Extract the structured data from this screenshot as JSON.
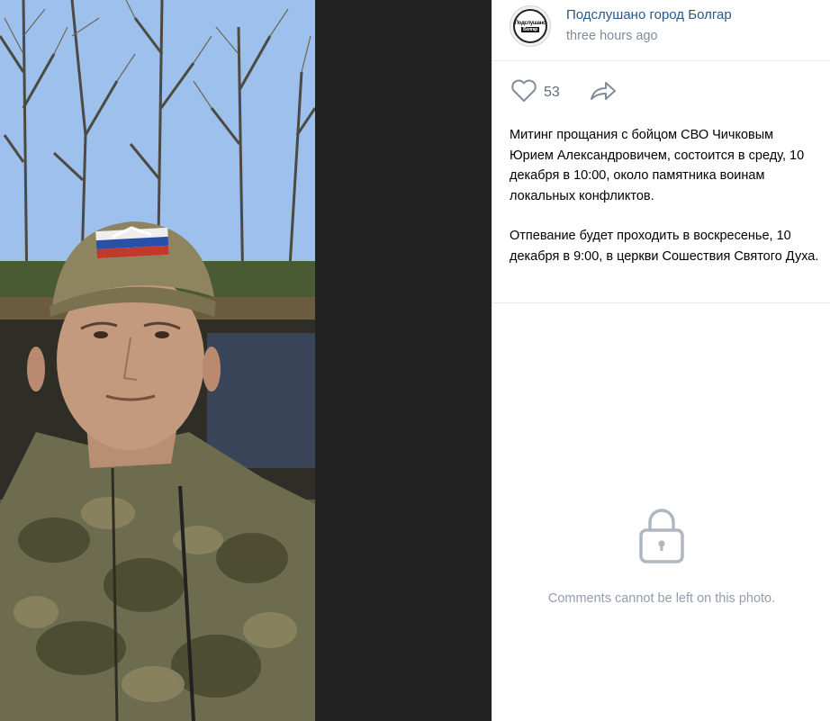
{
  "post": {
    "group_name": "Подслушано город Болгар",
    "time": "three hours ago",
    "avatar_text_line1": "Подслушано",
    "avatar_text_line2": "Болгар",
    "likes": "53",
    "paragraphs": [
      "Митинг прощания с бойцом СВО Чичковым Юрием Александровичем, состоится в среду, 10 декабря в 10:00, около памятника воинам локальных конфликтов.",
      "Отпевание будет проходить в воскресенье, 10 декабря в 9:00, в церкви Сошествия Святого Духа."
    ]
  },
  "comments": {
    "locked_message": "Comments cannot be left on this photo."
  },
  "icons": {
    "like": "heart-icon",
    "share": "share-arrow-icon",
    "lock": "lock-icon"
  },
  "colors": {
    "link": "#2a5885",
    "secondary": "#818c99",
    "viewer_bg": "#222222"
  }
}
